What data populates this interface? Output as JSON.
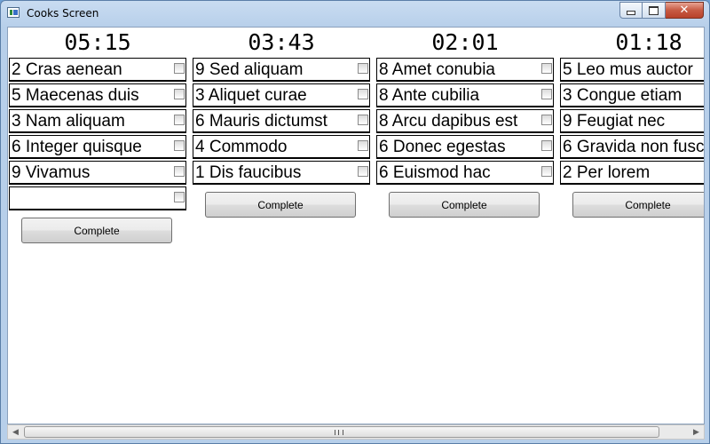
{
  "window": {
    "title": "Cooks Screen"
  },
  "orders": [
    {
      "timer": "05:15",
      "items": [
        "2 Cras aenean",
        "5 Maecenas duis",
        "3 Nam aliquam",
        "6 Integer quisque",
        "9 Vivamus",
        ""
      ],
      "complete_label": "Complete"
    },
    {
      "timer": "03:43",
      "items": [
        "9 Sed aliquam",
        "3 Aliquet curae",
        "6 Mauris dictumst",
        "4 Commodo",
        "1 Dis faucibus"
      ],
      "complete_label": "Complete"
    },
    {
      "timer": "02:01",
      "items": [
        "8 Amet conubia",
        "8 Ante cubilia",
        "8 Arcu dapibus est",
        "6 Donec egestas",
        "6 Euismod hac"
      ],
      "complete_label": "Complete"
    },
    {
      "timer": "01:18",
      "items": [
        "5 Leo mus auctor",
        "3 Congue etiam",
        "9 Feugiat nec",
        "6 Gravida non fusc",
        "2 Per lorem"
      ],
      "complete_label": "Complete"
    }
  ]
}
